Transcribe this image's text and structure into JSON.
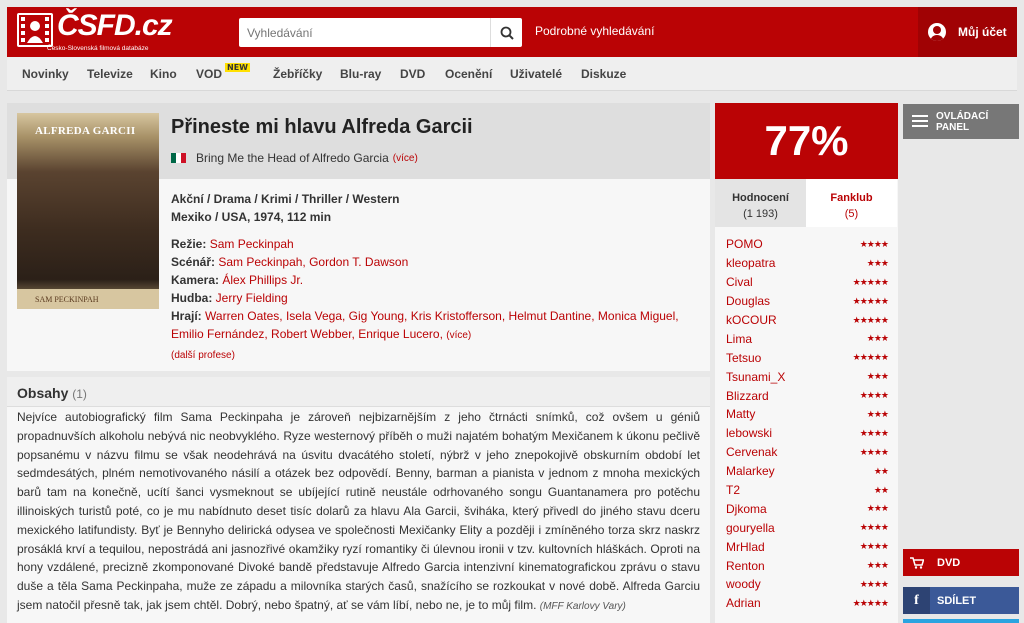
{
  "header": {
    "logo_text": "ČSFD.cz",
    "logo_subtitle": "Česko-Slovenská filmová databáze",
    "search_placeholder": "Vyhledávání",
    "advanced_search": "Podrobné vyhledávání",
    "account": "Můj účet"
  },
  "nav": {
    "items": [
      "Novinky",
      "Televize",
      "Kino",
      "VOD",
      "Žebříčky",
      "Blu-ray",
      "DVD",
      "Ocenění",
      "Uživatelé",
      "Diskuze"
    ],
    "new_badge": "NEW"
  },
  "film": {
    "title": "Přineste mi hlavu Alfreda Garcii",
    "original_title": "Bring Me the Head of Alfredo Garcia",
    "more": "(více)",
    "genres": "Akční / Drama / Krimi / Thriller / Western",
    "origin": "Mexiko / USA, 1974, 112 min",
    "poster_title": "ALFREDA GARCII",
    "poster_director": "SAM PECKINPAH",
    "crew": {
      "directing_label": "Režie:",
      "directing": "Sam Peckinpah",
      "writing_label": "Scénář:",
      "writing": "Sam Peckinpah, Gordon T. Dawson",
      "camera_label": "Kamera:",
      "camera": "Álex Phillips Jr.",
      "music_label": "Hudba:",
      "music": "Jerry Fielding",
      "cast_label": "Hrají:",
      "cast": "Warren Oates, Isela Vega, Gig Young, Kris Kristofferson, Helmut Dantine, Monica Miguel, Emilio Fernández, Robert Webber, Enrique Lucero,",
      "cast_more": "(více)",
      "more_professions": "(další profese)"
    }
  },
  "plots": {
    "heading": "Obsahy",
    "count": "(1)",
    "text": "Nejvíce autobiografický film Sama Peckinpaha je zároveň nejbizarnějším z jeho čtrnácti snímků, což ovšem u géniů propadnuvších alkoholu nebývá nic neobvyklého. Ryze westernový příběh o muži najatém bohatým Mexičanem k úkonu pečlivě popsanému v názvu filmu se však neodehrává na úsvitu dvacátého století, nýbrž v jeho znepokojivě obskurním období let sedmdesátých, plném nemotivovaného násilí a otázek bez odpovědí. Benny, barman a pianista v jednom z mnoha mexických barů tam na konečně, ucítí šanci vysmeknout se ubíjející rutině neustále odrhovaného songu Guantanamera pro potěchu illinoiských turistů poté, co je mu nabídnuto deset tisíc dolarů za hlavu Ala Garcii, šviháka, který přivedl do jiného stavu dceru mexického latifundisty. Byť je Bennyho delirická odysea ve společnosti Mexičanky Elity a později i zmíněného torza skrz naskrz prosáklá krví a tequilou, nepostrádá ani jasnozřivé okamžiky ryzí romantiky či úlevnou ironii v tzv. kultovních hláškách. Oproti na hony vzdálené, precizně zkomponované Divoké bandě představuje Alfredo Garcia intenzivní kinematografickou zprávu o stavu duše a těla Sama Peckinpaha, muže ze západu a milovníka starých časů, snažícího se rozkoukat v nové době. Alfreda Garciu jsem natočil přesně tak, jak jsem chtěl. Dobrý, nebo špatný, ať se vám líbí, nebo ne, je to můj film.",
    "source": "(MFF Karlovy Vary)"
  },
  "rating": {
    "percent": "77%",
    "tab_ratings": "Hodnocení",
    "tab_ratings_count": "(1 193)",
    "tab_fanclub": "Fanklub",
    "tab_fanclub_count": "(5)",
    "users": [
      {
        "name": "POMO",
        "stars": 4
      },
      {
        "name": "kleopatra",
        "stars": 3
      },
      {
        "name": "Cival",
        "stars": 5
      },
      {
        "name": "Douglas",
        "stars": 5
      },
      {
        "name": "kOCOUR",
        "stars": 5
      },
      {
        "name": "Lima",
        "stars": 3
      },
      {
        "name": "Tetsuo",
        "stars": 5
      },
      {
        "name": "Tsunami_X",
        "stars": 3
      },
      {
        "name": "Blizzard",
        "stars": 4
      },
      {
        "name": "Matty",
        "stars": 3
      },
      {
        "name": "lebowski",
        "stars": 4
      },
      {
        "name": "Cervenak",
        "stars": 4
      },
      {
        "name": "Malarkey",
        "stars": 2
      },
      {
        "name": "T2",
        "stars": 2
      },
      {
        "name": "Djkoma",
        "stars": 3
      },
      {
        "name": "gouryella",
        "stars": 4
      },
      {
        "name": "MrHlad",
        "stars": 4
      },
      {
        "name": "Renton",
        "stars": 3
      },
      {
        "name": "woody",
        "stars": 4
      },
      {
        "name": "Adrian",
        "stars": 5
      }
    ]
  },
  "side": {
    "panel_line1": "OVLÁDACÍ",
    "panel_line2": "PANEL",
    "dvd": "DVD",
    "share": "SDÍLET"
  },
  "colors": {
    "brand": "#ba0305",
    "facebook": "#3b5998",
    "flag_green": "#006847",
    "flag_red": "#ce1126"
  }
}
